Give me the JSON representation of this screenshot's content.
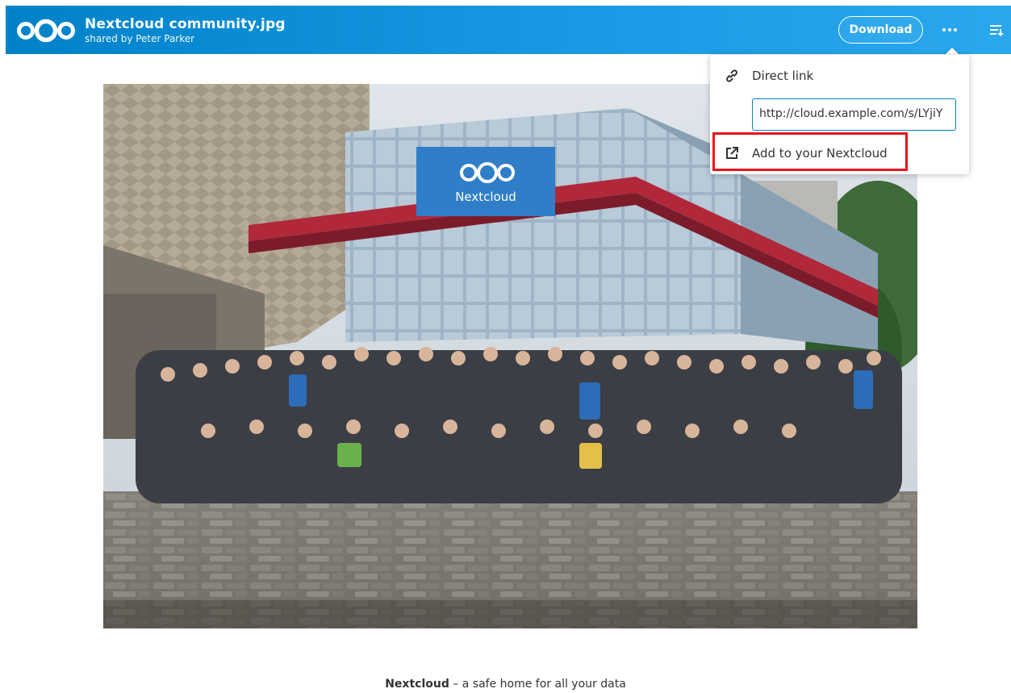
{
  "header": {
    "title": "Nextcloud community.jpg",
    "subtitle": "shared by Peter Parker",
    "download_label": "Download",
    "logo_icon": "nextcloud-logo-icon",
    "more_icon": "three-dots-icon",
    "filter_icon": "details-toggle-icon",
    "brand_color": "#0082c9"
  },
  "menu": {
    "direct_link_label": "Direct link",
    "direct_link_value": "http://cloud.example.com/s/LYjiY",
    "add_label": "Add to your Nextcloud",
    "direct_link_icon": "link-icon",
    "add_icon": "external-link-icon",
    "highlight_color": "#e8141e"
  },
  "photo": {
    "banner_text": "Nextcloud"
  },
  "footer": {
    "brand": "Nextcloud",
    "tagline": " – a safe home for all your data"
  }
}
